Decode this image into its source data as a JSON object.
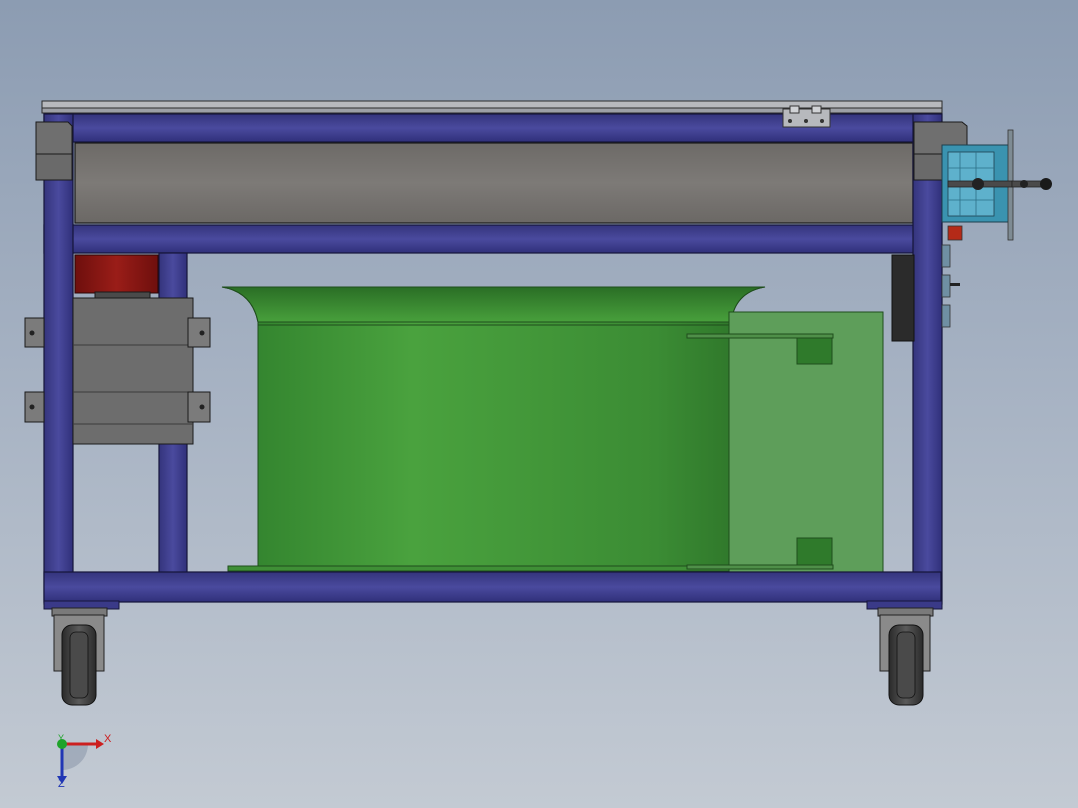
{
  "viewport": {
    "background_top": "#8c9cb2",
    "background_bottom": "#c3cad3"
  },
  "model": {
    "frame_color": "#3f3f8f",
    "frame_edge_color": "#15153a",
    "panel_color": "#7a7774",
    "drum_color": "#43963a",
    "plate_color": "#5e9e5a",
    "motor_color": "#8a1512",
    "bracket_color": "#6f6f6f",
    "handwheel_color": "#3a93b0",
    "wheel_color": "#3a3a3a"
  },
  "triad": {
    "x_label": "X",
    "y_label": "Y",
    "z_label": "Z",
    "x_color": "#cc1f1f",
    "y_color": "#1fa32a",
    "z_color": "#2036b4"
  }
}
